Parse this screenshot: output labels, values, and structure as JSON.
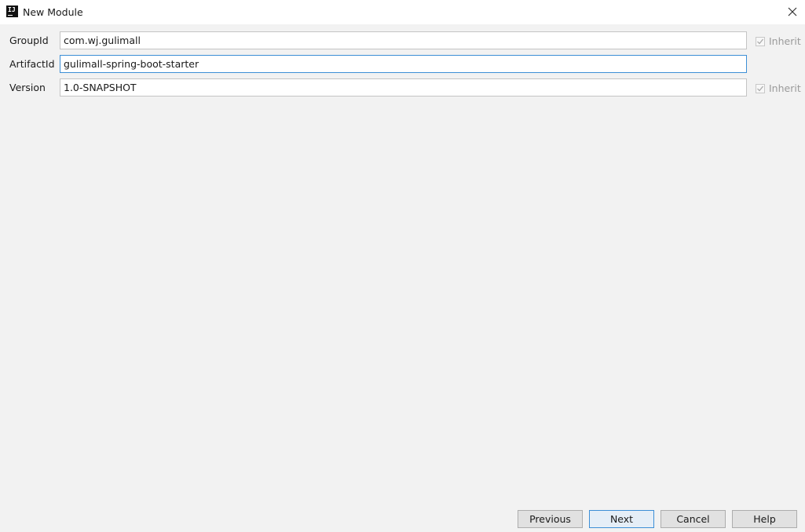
{
  "window": {
    "title": "New Module",
    "app_icon_text": "IJ",
    "close_icon": "close-icon"
  },
  "form": {
    "group_id": {
      "label": "GroupId",
      "value": "com.wj.gulimall",
      "inherit_label": "Inherit",
      "inherit_checked": true
    },
    "artifact_id": {
      "label": "ArtifactId",
      "value": "gulimall-spring-boot-starter"
    },
    "version": {
      "label": "Version",
      "value": "1.0-SNAPSHOT",
      "inherit_label": "Inherit",
      "inherit_checked": true
    }
  },
  "buttons": {
    "previous": "Previous",
    "next": "Next",
    "cancel": "Cancel",
    "help": "Help"
  },
  "colors": {
    "focus_border": "#3d8fd6",
    "dialog_bg": "#f2f2f2",
    "disabled_text": "#9a9a9a"
  }
}
